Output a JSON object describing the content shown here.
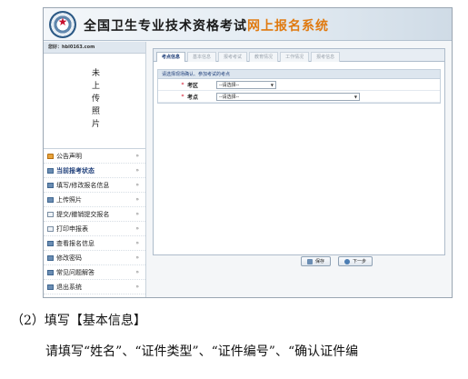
{
  "header": {
    "title_main": "全国卫生专业技术资格考试",
    "title_highlight": "网上报名系统"
  },
  "sidebar": {
    "user_label": "您好：hbl0163.com",
    "photo_placeholder": "未上传照片",
    "items": [
      {
        "label": "公告声明",
        "icon": "home-icon"
      },
      {
        "label": "当前报考状态",
        "icon": "doc-icon"
      },
      {
        "label": "填写/修改报名信息",
        "icon": "doc-icon"
      },
      {
        "label": "上传照片",
        "icon": "doc-icon"
      },
      {
        "label": "提交/撤销提交报名",
        "icon": "page-icon"
      },
      {
        "label": "打印申报表",
        "icon": "page-icon"
      },
      {
        "label": "查看报名信息",
        "icon": "doc-icon"
      },
      {
        "label": "修改密码",
        "icon": "doc-icon"
      },
      {
        "label": "常见问题解答",
        "icon": "doc-icon"
      },
      {
        "label": "退出系统",
        "icon": "doc-icon"
      }
    ]
  },
  "main": {
    "tabs": [
      {
        "label": "考点信息",
        "active": true
      },
      {
        "label": "基本信息",
        "active": false
      },
      {
        "label": "报考考试",
        "active": false
      },
      {
        "label": "教育情况",
        "active": false
      },
      {
        "label": "工作情况",
        "active": false
      },
      {
        "label": "报考信息",
        "active": false
      }
    ],
    "panel_title": "请选择现场确认、参加考试的考点",
    "fields": [
      {
        "required_mark": "*",
        "label": "考区",
        "value": "--请选择--"
      },
      {
        "required_mark": "*",
        "label": "考点",
        "value": "--请选择--"
      }
    ],
    "buttons": {
      "save": "保存",
      "next": "下一步"
    }
  },
  "document": {
    "step_heading": "（2）填写【基本信息】",
    "instruction": "请填写“姓名”、“证件类型”、“证件编号”、“确认证件编"
  },
  "colors": {
    "accent": "#1f3f7a",
    "highlight": "#e07a10",
    "required": "#d0021b"
  }
}
